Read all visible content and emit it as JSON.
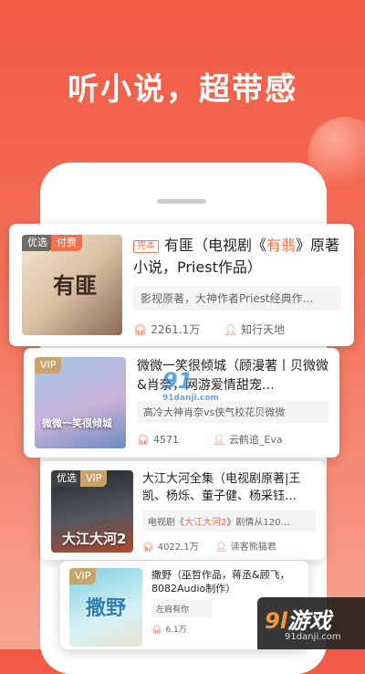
{
  "headline": "听小说，超带感",
  "books": [
    {
      "tags": [
        "优选",
        "付费"
      ],
      "badge": "完本",
      "title_pre": "有匪（电视剧《",
      "title_hl": "有翡",
      "title_post": "》原著小说，Priest作品）",
      "desc": "影视原著，大神作者Priest经典作...",
      "plays": "2261.1万",
      "narrator": "知行天地",
      "cover_text": "有匪"
    },
    {
      "tags": [
        "VIP"
      ],
      "title": "微微一笑很倾城（顾漫著丨贝微微&肖奈，网游爱情甜宠…",
      "desc": "高冷大神肖奈vs侠气校花贝微微",
      "plays": "4571",
      "narrator": "云鹤追_Eva",
      "cover_text": "微微一笑很倾城"
    },
    {
      "tags": [
        "优选",
        "VIP"
      ],
      "title": "大江大河全集（电视剧原著|王凯、杨烁、董子健、杨采钰…",
      "desc_pre": "电视剧《",
      "desc_hl": "大江大河2",
      "desc_post": "》剧情从120…",
      "plays": "4022.1万",
      "narrator": "读客熊猫君",
      "cover_text": "大江大河2"
    },
    {
      "tags": [
        "VIP"
      ],
      "title": "撒野（巫哲作品，蒋丞&顾飞，8082Audio制作）",
      "desc": "左肩有你",
      "plays": "6.1万",
      "narrator": "",
      "cover_text": "撒野"
    }
  ],
  "watermark": {
    "mid": "91",
    "mid_url": "91danji.com",
    "logo_num": "9l",
    "logo_text": "游戏",
    "url": "91danji.com"
  },
  "icons": {
    "plays": "headphones-icon",
    "narrator": "person-icon"
  },
  "colors": {
    "accent": "#f3724d",
    "vip": "#c9a46a",
    "background_top": "#f25a44"
  }
}
